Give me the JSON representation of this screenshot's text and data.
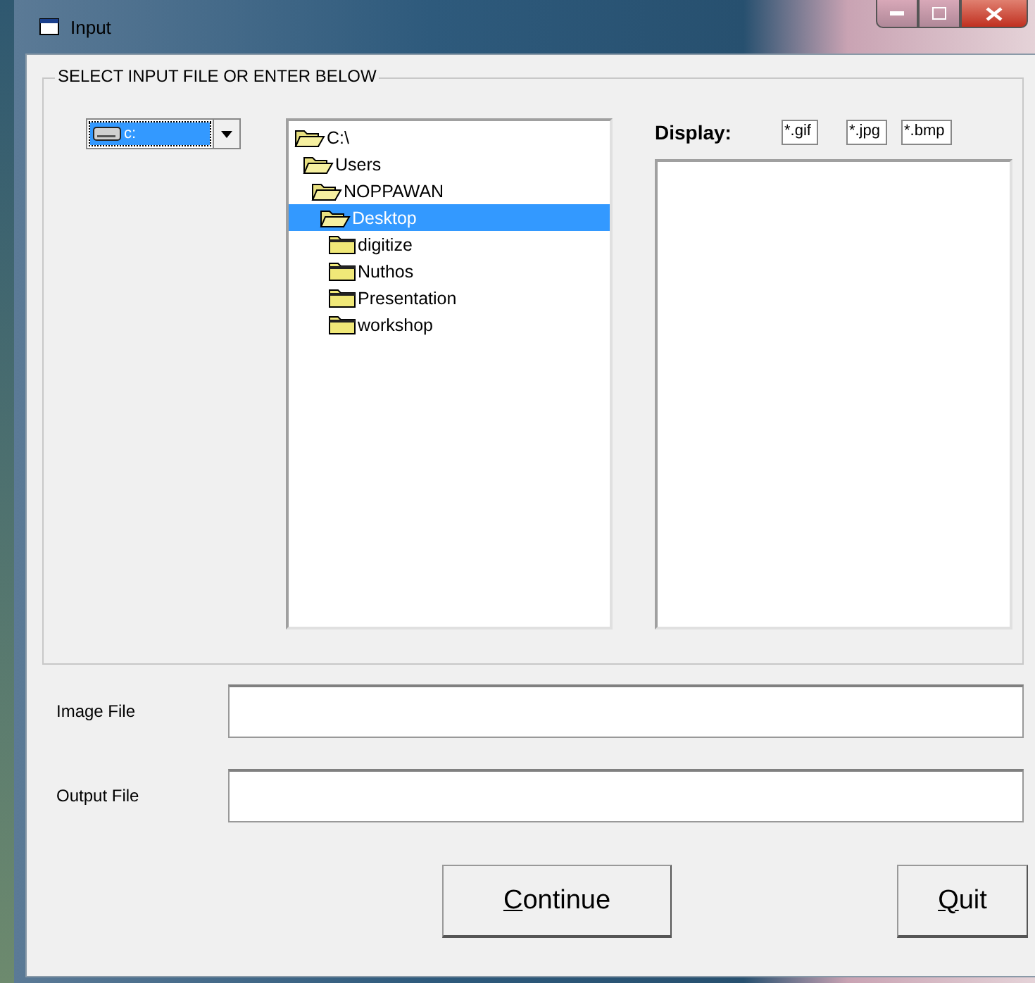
{
  "window": {
    "title": "Input"
  },
  "group": {
    "title": "SELECT INPUT FILE OR ENTER BELOW"
  },
  "drive": {
    "value": "c:"
  },
  "tree": [
    {
      "label": "C:\\",
      "expanded": true,
      "selected": false,
      "children": [
        {
          "label": "Users",
          "expanded": true,
          "selected": false,
          "children": [
            {
              "label": "NOPPAWAN",
              "expanded": true,
              "selected": false,
              "children": [
                {
                  "label": "Desktop",
                  "expanded": true,
                  "selected": true,
                  "children": [
                    {
                      "label": "digitize",
                      "expanded": false,
                      "selected": false
                    },
                    {
                      "label": "Nuthos",
                      "expanded": false,
                      "selected": false
                    },
                    {
                      "label": "Presentation",
                      "expanded": false,
                      "selected": false
                    },
                    {
                      "label": "workshop",
                      "expanded": false,
                      "selected": false
                    }
                  ]
                }
              ]
            }
          ]
        }
      ]
    }
  ],
  "display": {
    "label": "Display:",
    "filters": [
      "*.gif",
      "*.jpg",
      "*.bmp"
    ]
  },
  "fields": [
    {
      "label": "Image File"
    },
    {
      "label": "Output File"
    }
  ],
  "buttons": [
    {
      "label": "Continue",
      "kind": "wide"
    },
    {
      "label": "Quit",
      "kind": "narrow"
    }
  ]
}
